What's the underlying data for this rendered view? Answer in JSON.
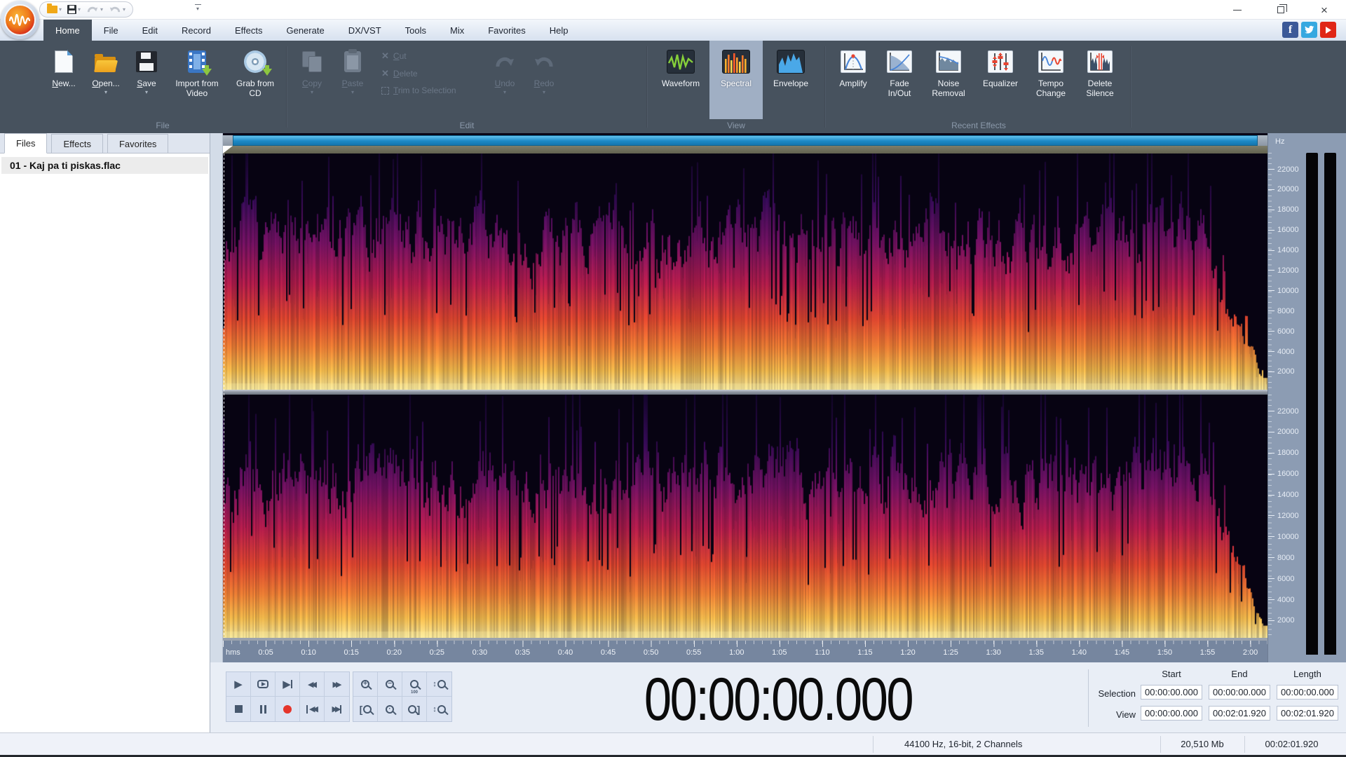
{
  "window": {
    "controls": {
      "minimize": "minimize",
      "restore": "restore",
      "close": "close"
    }
  },
  "quick_access": {
    "items": [
      "open-folder-icon",
      "save-icon",
      "undo-icon",
      "redo-icon"
    ],
    "customize": "toolbar-options-icon"
  },
  "menu": {
    "tabs": [
      {
        "label": "Home",
        "active": true
      },
      {
        "label": "File",
        "active": false
      },
      {
        "label": "Edit",
        "active": false
      },
      {
        "label": "Record",
        "active": false
      },
      {
        "label": "Effects",
        "active": false
      },
      {
        "label": "Generate",
        "active": false
      },
      {
        "label": "DX/VST",
        "active": false
      },
      {
        "label": "Tools",
        "active": false
      },
      {
        "label": "Mix",
        "active": false
      },
      {
        "label": "Favorites",
        "active": false
      },
      {
        "label": "Help",
        "active": false
      }
    ]
  },
  "social": [
    "facebook-icon",
    "twitter-icon",
    "youtube-icon"
  ],
  "ribbon": {
    "groups": [
      {
        "label": "File",
        "buttons": [
          {
            "label": "New...",
            "icon": "new-document-icon"
          },
          {
            "label": "Open...",
            "icon": "open-folder-icon",
            "dropdown": true
          },
          {
            "label": "Save",
            "icon": "save-icon",
            "dropdown": true
          },
          {
            "label": "Import from Video",
            "icon": "import-video-icon"
          },
          {
            "label": "Grab from CD",
            "icon": "grab-cd-icon"
          }
        ]
      },
      {
        "label": "Edit",
        "buttons": [
          {
            "label": "Copy",
            "icon": "copy-icon",
            "dropdown": true,
            "disabled": true
          },
          {
            "label": "Paste",
            "icon": "paste-icon",
            "dropdown": true,
            "disabled": true
          },
          {
            "label": "Cut",
            "icon": "cut-icon",
            "disabled": true
          },
          {
            "label": "Delete",
            "icon": "delete-icon",
            "disabled": true
          },
          {
            "label": "Trim to Selection",
            "icon": "trim-icon",
            "disabled": true
          },
          {
            "label": "Undo",
            "icon": "undo-icon",
            "dropdown": true,
            "disabled": true
          },
          {
            "label": "Redo",
            "icon": "redo-icon",
            "dropdown": true,
            "disabled": true
          }
        ]
      },
      {
        "label": "View",
        "buttons": [
          {
            "label": "Waveform",
            "icon": "waveform-view-icon",
            "active": false
          },
          {
            "label": "Spectral",
            "icon": "spectral-view-icon",
            "active": true
          },
          {
            "label": "Envelope",
            "icon": "envelope-view-icon",
            "active": false
          }
        ]
      },
      {
        "label": "Recent Effects",
        "buttons": [
          {
            "label": "Amplify",
            "icon": "amplify-icon"
          },
          {
            "label": "Fade In/Out",
            "icon": "fade-icon"
          },
          {
            "label": "Noise Removal",
            "icon": "noise-removal-icon"
          },
          {
            "label": "Equalizer",
            "icon": "equalizer-icon"
          },
          {
            "label": "Tempo Change",
            "icon": "tempo-change-icon"
          },
          {
            "label": "Delete Silence",
            "icon": "delete-silence-icon"
          }
        ]
      }
    ]
  },
  "panel": {
    "tabs": [
      {
        "label": "Files",
        "active": true
      },
      {
        "label": "Effects",
        "active": false
      },
      {
        "label": "Favorites",
        "active": false
      }
    ],
    "files": [
      {
        "name": "01 - Kaj pa ti piskas.flac"
      }
    ]
  },
  "spectral_view": {
    "freq_unit": "Hz",
    "freq_labels": [
      "22000",
      "20000",
      "18000",
      "16000",
      "14000",
      "12000",
      "10000",
      "8000",
      "6000",
      "4000",
      "2000"
    ],
    "channels": 2,
    "ruler": {
      "origin_label": "hms",
      "label_interval_seconds": 5,
      "total_seconds": 122,
      "ticks": [
        "0:05",
        "0:10",
        "0:15",
        "0:20",
        "0:25",
        "0:30",
        "0:35",
        "0:40",
        "0:45",
        "0:50",
        "0:55",
        "1:00",
        "1:05",
        "1:10",
        "1:15",
        "1:20",
        "1:25",
        "1:30",
        "1:35",
        "1:40",
        "1:45",
        "1:50",
        "1:55",
        "2:00"
      ]
    }
  },
  "transport": {
    "row1": [
      "play-icon",
      "loop-playback-icon",
      "play-to-end-icon",
      "rewind-icon",
      "fast-forward-icon"
    ],
    "row2": [
      "stop-icon",
      "pause-icon",
      "record-icon",
      "go-to-start-icon",
      "go-to-end-icon"
    ]
  },
  "zoom_controls": {
    "row1": [
      "zoom-in-icon",
      "zoom-out-icon",
      "zoom-100-icon",
      "zoom-vertical-in-icon"
    ],
    "row2": [
      "zoom-selection-start-icon",
      "zoom-selection-icon",
      "zoom-selection-end-icon",
      "zoom-vertical-out-icon"
    ]
  },
  "time_display": "00:00:00.000",
  "selection_panel": {
    "columns": [
      "Start",
      "End",
      "Length"
    ],
    "rows": [
      {
        "label": "Selection",
        "values": [
          "00:00:00.000",
          "00:00:00.000",
          "00:00:00.000"
        ]
      },
      {
        "label": "View",
        "values": [
          "00:00:00.000",
          "00:02:01.920",
          "00:02:01.920"
        ]
      }
    ]
  },
  "status_bar": {
    "format": "44100 Hz, 16-bit, 2 Channels",
    "size": "20,510 Mb",
    "length": "00:02:01.920"
  },
  "colors": {
    "accent_blue": "#2196d9",
    "ribbon_bg": "#47525e",
    "record_red": "#e5352b",
    "facebook": "#3b5998",
    "twitter": "#36a8e0",
    "youtube": "#e02717",
    "spectrogram_palette": [
      "#14052e",
      "#3b0b5e",
      "#7c1268",
      "#c21e50",
      "#ec4a30",
      "#fb8636",
      "#ffc44f",
      "#ffefa0"
    ]
  }
}
